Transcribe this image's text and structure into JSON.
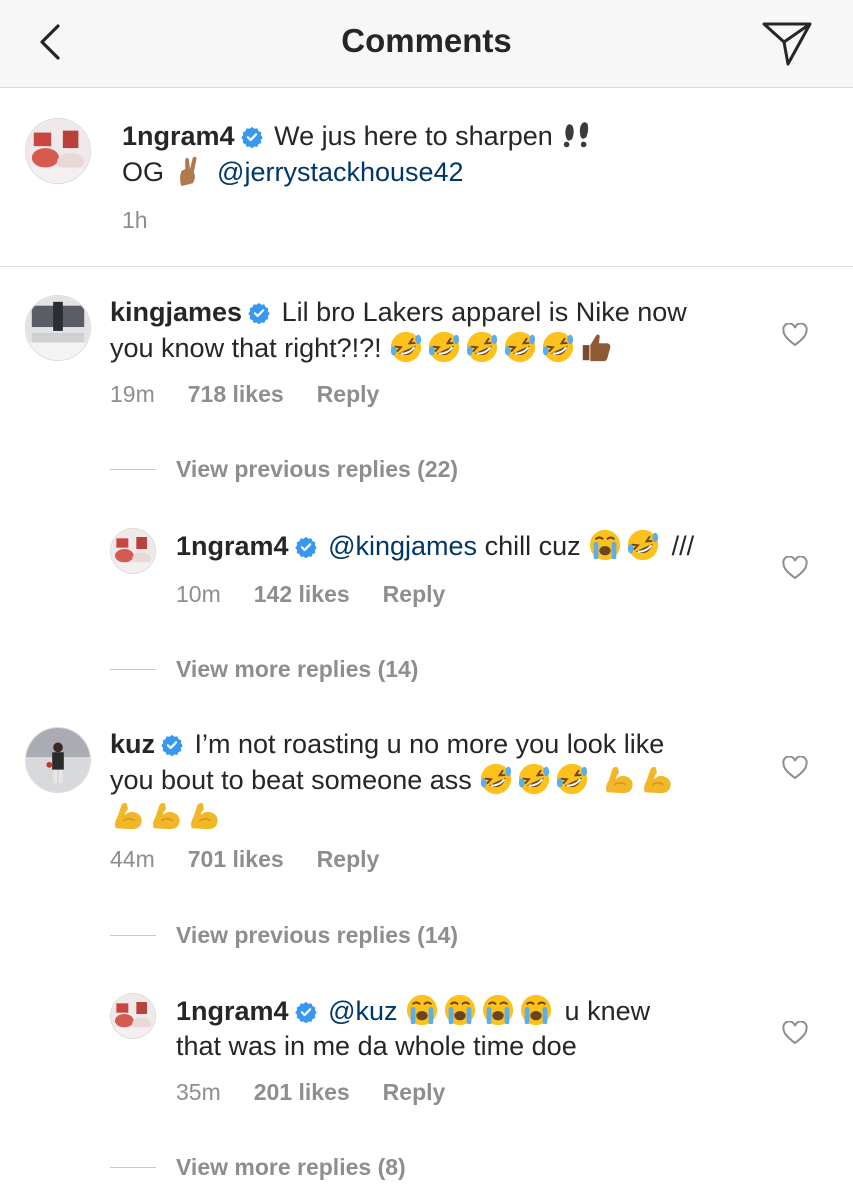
{
  "header": {
    "title": "Comments"
  },
  "caption": {
    "username": "1ngram4",
    "text_line1": "We jus here to sharpen",
    "text_line2": "OG",
    "mention": "@jerrystackhouse42",
    "time": "1h"
  },
  "comments": [
    {
      "username": "kingjames",
      "line1": "Lil bro Lakers apparel is Nike now",
      "line2": "you know that right?!?!",
      "time": "19m",
      "likes": "718 likes",
      "reply": "Reply",
      "view_replies": "View previous replies (22)"
    },
    {
      "username": "1ngram4",
      "mention": "@kingjames",
      "text": "chill cuz",
      "tail": "///",
      "time": "10m",
      "likes": "142 likes",
      "reply": "Reply",
      "view_replies": "View more replies (14)"
    },
    {
      "username": "kuz",
      "line1": "I’m not roasting u no more you look like",
      "line2": "you bout to beat someone ass",
      "time": "44m",
      "likes": "701 likes",
      "reply": "Reply",
      "view_replies": "View previous replies (14)"
    },
    {
      "username": "1ngram4",
      "mention": "@kuz",
      "text": "u knew",
      "line2": "that was in me da whole time doe",
      "time": "35m",
      "likes": "201 likes",
      "reply": "Reply",
      "view_replies": "View more replies (8)"
    }
  ],
  "colors": {
    "verified": "#3897f0",
    "mention": "#00376b",
    "muted": "#8e8e8e"
  },
  "icons": [
    "back-icon",
    "direct-share-icon",
    "verified-badge-icon",
    "heart-icon",
    "footprints-emoji",
    "crossed-fingers-emoji",
    "rofl-emoji",
    "thumbs-up-emoji",
    "crying-emoji",
    "flexed-biceps-emoji"
  ]
}
